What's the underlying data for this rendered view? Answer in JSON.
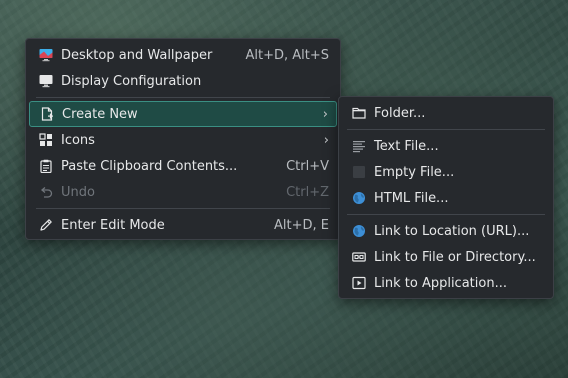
{
  "main_menu": {
    "items": [
      {
        "label": "Desktop and Wallpaper",
        "shortcut": "Alt+D, Alt+S",
        "icon": "desktop-wallpaper-icon"
      },
      {
        "label": "Display Configuration",
        "shortcut": "",
        "icon": "monitor-icon"
      },
      {
        "label": "Create New",
        "shortcut": "",
        "icon": "new-document-icon",
        "submenu": true,
        "highlighted": true
      },
      {
        "label": "Icons",
        "shortcut": "",
        "icon": "grid-icon",
        "submenu": true
      },
      {
        "label": "Paste Clipboard Contents...",
        "shortcut": "Ctrl+V",
        "icon": "clipboard-icon"
      },
      {
        "label": "Undo",
        "shortcut": "Ctrl+Z",
        "icon": "undo-icon",
        "disabled": true
      },
      {
        "label": "Enter Edit Mode",
        "shortcut": "Alt+D, E",
        "icon": "pencil-icon"
      }
    ]
  },
  "submenu": {
    "items": [
      {
        "label": "Folder...",
        "icon": "folder-icon"
      },
      {
        "label": "Text File...",
        "icon": "text-file-icon"
      },
      {
        "label": "Empty File...",
        "icon": "empty-file-icon"
      },
      {
        "label": "HTML File...",
        "icon": "globe-icon"
      },
      {
        "label": "Link to Location (URL)...",
        "icon": "globe-icon"
      },
      {
        "label": "Link to File or Directory...",
        "icon": "link-drive-icon"
      },
      {
        "label": "Link to Application...",
        "icon": "application-icon"
      }
    ]
  },
  "colors": {
    "menu_bg": "#26292d",
    "highlight_bg": "#1f4b45",
    "highlight_border": "#3a8f83",
    "text": "#e7e8e9",
    "disabled_text": "#70757b"
  }
}
